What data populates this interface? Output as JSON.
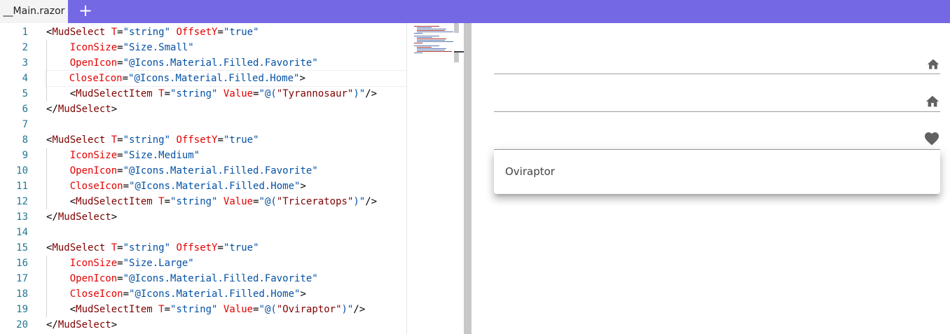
{
  "tabs": [
    {
      "label": "__Main.razor",
      "active": true
    }
  ],
  "add_tab_label": "+",
  "editor": {
    "line_numbers": [
      "1",
      "2",
      "3",
      "4",
      "5",
      "6",
      "7",
      "8",
      "9",
      "10",
      "11",
      "12",
      "13",
      "14",
      "15",
      "16",
      "17",
      "18",
      "19",
      "20"
    ],
    "current_line": 4,
    "lines": [
      "<MudSelect T=\"string\" OffsetY=\"true\"",
      "    IconSize=\"Size.Small\"",
      "    OpenIcon=\"@Icons.Material.Filled.Favorite\"",
      "    CloseIcon=\"@Icons.Material.Filled.Home\">",
      "    <MudSelectItem T=\"string\" Value=\"@(\"Tyrannosaur\")\"/>",
      "</MudSelect>",
      "",
      "<MudSelect T=\"string\" OffsetY=\"true\"",
      "    IconSize=\"Size.Medium\"",
      "    OpenIcon=\"@Icons.Material.Filled.Favorite\"",
      "    CloseIcon=\"@Icons.Material.Filled.Home\">",
      "    <MudSelectItem T=\"string\" Value=\"@(\"Triceratops\")\"/>",
      "</MudSelect>",
      "",
      "<MudSelect T=\"string\" OffsetY=\"true\"",
      "    IconSize=\"Size.Large\"",
      "    OpenIcon=\"@Icons.Material.Filled.Favorite\"",
      "    CloseIcon=\"@Icons.Material.Filled.Home\">",
      "    <MudSelectItem T=\"string\" Value=\"@(\"Oviraptor\")\"/>",
      "</MudSelect>"
    ]
  },
  "preview": {
    "selects": [
      {
        "icon": "home-icon",
        "icon_size": "Small"
      },
      {
        "icon": "home-icon",
        "icon_size": "Medium"
      },
      {
        "icon": "favorite-icon",
        "icon_size": "Large",
        "open": true
      }
    ],
    "open_options": [
      "Oviraptor"
    ]
  },
  "colors": {
    "topbar": "#7468e4",
    "tag": "#800000",
    "attribute": "#e50000",
    "value": "#0451a5",
    "line_number": "#237893"
  }
}
